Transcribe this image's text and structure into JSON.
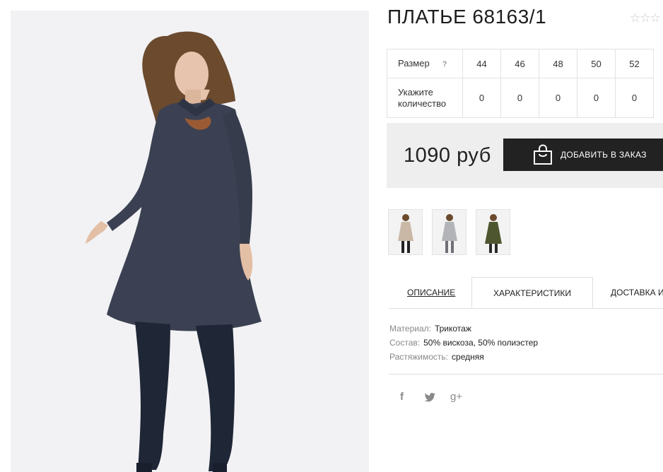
{
  "product": {
    "title": "ПЛАТЬЕ 68163/1",
    "rating_stars": "☆☆☆"
  },
  "sizes": {
    "size_label": "Размер",
    "help": "?",
    "qty_label_1": "Укажите",
    "qty_label_2": "количество",
    "values": [
      "44",
      "46",
      "48",
      "50",
      "52"
    ],
    "quantities": [
      "0",
      "0",
      "0",
      "0",
      "0"
    ]
  },
  "purchase": {
    "price": "1090 руб",
    "add_button": "ДОБАВИТЬ В ЗАКАЗ"
  },
  "thumbnails": [
    {
      "name": "beige-dress-variant",
      "color": "#c9b8a6"
    },
    {
      "name": "grey-dress-variant",
      "color": "#b3b4b8"
    },
    {
      "name": "olive-dress-variant",
      "color": "#4e5630"
    }
  ],
  "tabs": {
    "description": "ОПИСАНИЕ",
    "characteristics": "ХАРАКТЕРИСТИКИ",
    "delivery": "ДОСТАВКА И"
  },
  "specs": [
    {
      "key": "Материал:",
      "value": "Трикотаж"
    },
    {
      "key": "Состав:",
      "value": "50% вискоза, 50% полиэстер"
    },
    {
      "key": "Растяжимость:",
      "value": "средняя"
    }
  ],
  "social": {
    "facebook": "f",
    "twitter": "twitter-icon",
    "googleplus": "g+"
  },
  "colors": {
    "dress": "#3b4152",
    "button_bg": "#222222",
    "price_bg": "#eeeeee"
  }
}
